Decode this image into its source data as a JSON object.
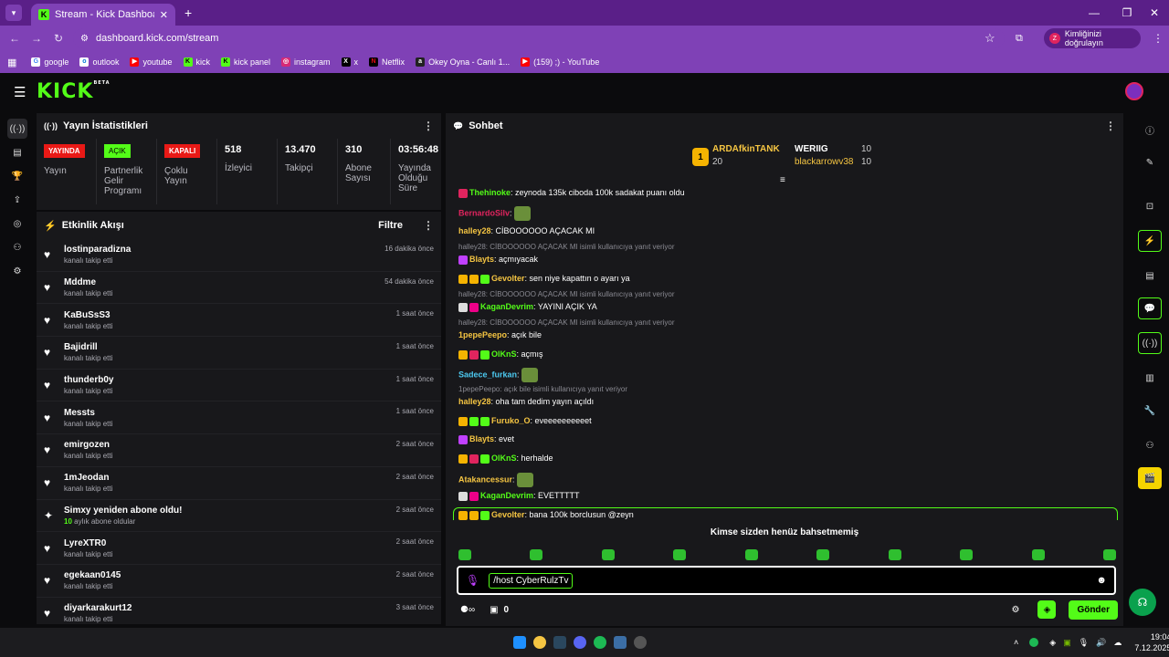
{
  "browser": {
    "tab_title": "Stream - Kick Dashboard",
    "url": "dashboard.kick.com/stream",
    "identity_button": "Kimliğinizi doğrulayın",
    "identity_initial": "Z",
    "bookmarks": [
      "google",
      "outlook",
      "youtube",
      "kick",
      "kick panel",
      "instagram",
      "x",
      "Netflix",
      "Okey Oyna - Canlı 1...",
      "(159) ;) - YouTube"
    ]
  },
  "logo": {
    "text": "KICK",
    "beta": "BETA"
  },
  "stats_panel": {
    "title": "Yayın İstatistikleri",
    "stats": [
      {
        "badge": "YAYINDA",
        "badge_color": "#e91916",
        "label": "Yayın"
      },
      {
        "badge": "AÇIK",
        "badge_color": "#53fc18",
        "label": "Partnerlik Gelir Programı"
      },
      {
        "badge": "KAPALI",
        "badge_color": "#e91916",
        "label": "Çoklu Yayın"
      },
      {
        "value": "518",
        "label": "İzleyici"
      },
      {
        "value": "13.470",
        "label": "Takipçi"
      },
      {
        "value": "310",
        "label": "Abone Sayısı"
      },
      {
        "value": "03:56:48",
        "label": "Yayında Olduğu Süre"
      }
    ]
  },
  "activity": {
    "title": "Etkinlik Akışı",
    "filter": "Filtre",
    "items": [
      {
        "name": "lostinparadizna",
        "sub": "kanalı takip etti",
        "time": "16 dakika önce"
      },
      {
        "name": "Mddme",
        "sub": "kanalı takip etti",
        "time": "54 dakika önce"
      },
      {
        "name": "KaBuSsS3",
        "sub": "kanalı takip etti",
        "time": "1 saat önce"
      },
      {
        "name": "Bajidrill",
        "sub": "kanalı takip etti",
        "time": "1 saat önce"
      },
      {
        "name": "thunderb0y",
        "sub": "kanalı takip etti",
        "time": "1 saat önce"
      },
      {
        "name": "Messts",
        "sub": "kanalı takip etti",
        "time": "1 saat önce"
      },
      {
        "name": "emirgozen",
        "sub": "kanalı takip etti",
        "time": "2 saat önce"
      },
      {
        "name": "1mJeodan",
        "sub": "kanalı takip etti",
        "time": "2 saat önce"
      },
      {
        "name": "Simxy yeniden abone oldu!",
        "sub_num": "10",
        "sub": "aylık abone oldular",
        "time": "2 saat önce"
      },
      {
        "name": "LyreXTR0",
        "sub": "kanalı takip etti",
        "time": "2 saat önce"
      },
      {
        "name": "egekaan0145",
        "sub": "kanalı takip etti",
        "time": "2 saat önce"
      },
      {
        "name": "diyarkarakurt12",
        "sub": "kanalı takip etti",
        "time": "3 saat önce"
      }
    ]
  },
  "chat": {
    "title": "Sohbet",
    "leaders": [
      {
        "rank": "1",
        "name": "ARDAfkinTANK",
        "count": "20"
      },
      {
        "name": "WERIIG",
        "count": "10"
      },
      {
        "name": "blackarrowv38",
        "count": "10"
      }
    ],
    "messages": [
      {
        "user": "Thehinoke",
        "color": "#53fc18",
        "text": "zeynoda 135k ciboda 100k sadakat puanı oldu"
      },
      {
        "user": "BernardoSilv",
        "color": "#e0245e",
        "text": ""
      },
      {
        "user": "halley28",
        "color": "#f5c542",
        "text": "CİBOOOOOO AÇACAK MI"
      },
      {
        "reply": "halley28: CİBOOOOOO AÇACAK MI isimli kullanıcıya yanıt veriyor"
      },
      {
        "user": "Blayts",
        "color": "#f5c542",
        "text": "açmıyacak"
      },
      {
        "user": "Gevolter",
        "color": "#f5c542",
        "text": "sen niye kapattın o ayarı ya"
      },
      {
        "reply": "halley28: CİBOOOOOO AÇACAK MI isimli kullanıcıya yanıt veriyor"
      },
      {
        "user": "KaganDevrim",
        "color": "#53fc18",
        "text": "YAYINI AÇIK YA"
      },
      {
        "reply": "halley28: CİBOOOOOO AÇACAK MI isimli kullanıcıya yanıt veriyor"
      },
      {
        "user": "1pepePeepo",
        "color": "#f5c542",
        "text": "açık bile"
      },
      {
        "user": "OlKnS",
        "color": "#53fc18",
        "text": "açmış"
      },
      {
        "user": "Sadece_furkan",
        "color": "#4cc9f0",
        "text": ""
      },
      {
        "reply": "1pepePeepo: açık bile isimli kullanıcıya yanıt veriyor"
      },
      {
        "user": "halley28",
        "color": "#f5c542",
        "text": "oha tam dedim yayın açıldı"
      },
      {
        "user": "Furuko_O",
        "color": "#f5c542",
        "text": "eveeeeeeeeeet"
      },
      {
        "user": "Blayts",
        "color": "#f5c542",
        "text": "evet"
      },
      {
        "user": "OlKnS",
        "color": "#53fc18",
        "text": "herhalde"
      },
      {
        "user": "Atakancessur",
        "color": "#f5c542",
        "text": ""
      },
      {
        "user": "KaganDevrim",
        "color": "#53fc18",
        "text": "EVETTTTT"
      },
      {
        "user": "Gevolter",
        "color": "#f5c542",
        "text": "bana 100k borclusun @zeyn"
      }
    ],
    "mentions_empty": "Kimse sizden henüz bahsetmemiş",
    "input_value": "/host CyberRulzTv",
    "points": "0",
    "send_button": "Gönder"
  },
  "taskbar": {
    "time": "19:04",
    "date": "7.12.2025"
  }
}
